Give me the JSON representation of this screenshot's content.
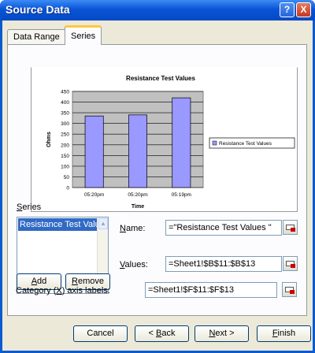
{
  "window": {
    "title": "Source Data"
  },
  "titlebar_buttons": {
    "help": "?",
    "close": "X"
  },
  "tabs": [
    {
      "label": "Data Range"
    },
    {
      "label": "Series"
    }
  ],
  "chart_data": {
    "type": "bar",
    "title": "Resistance Test Values",
    "xlabel": "Time",
    "ylabel": "Ohms",
    "categories": [
      "05:20pm",
      "05:20pm",
      "05:19pm"
    ],
    "series": [
      {
        "name": "Resistance Test Values",
        "values": [
          335,
          340,
          420
        ],
        "color": "#9999ff"
      }
    ],
    "ylim": [
      0,
      450
    ],
    "yticks": [
      "0",
      "50",
      "100",
      "150",
      "200",
      "250",
      "300",
      "350",
      "400",
      "450"
    ],
    "grid": true,
    "legend": "right"
  },
  "series_section": {
    "label": "Series",
    "list_items": [
      "Resistance Test Values"
    ],
    "add_button": "Add",
    "remove_button": "Remove"
  },
  "fields": {
    "name_label": "Name:",
    "name_value": "=\"Resistance Test Values \"",
    "values_label": "Values:",
    "values_value": "=Sheet1!$B$11:$B$13",
    "category_label": "Category (X) axis labels:",
    "category_value": "=Sheet1!$F$11:$F$13"
  },
  "footer_buttons": {
    "cancel": "Cancel",
    "back": "< Back",
    "next": "Next >",
    "finish": "Finish"
  }
}
